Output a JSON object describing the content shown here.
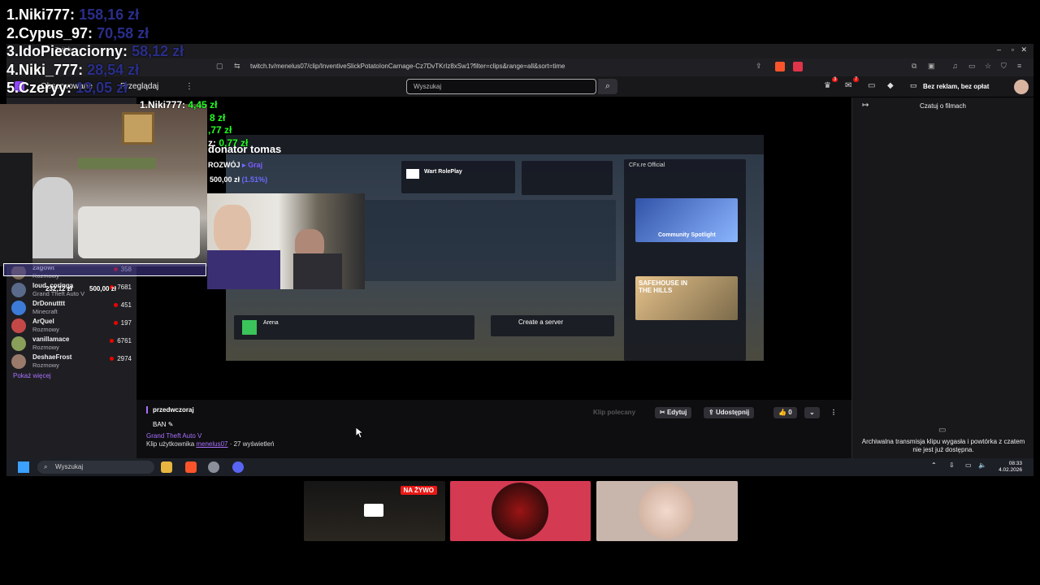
{
  "leaderboard": [
    {
      "rank_name": "1.Niki777:",
      "amount": "158,16 zł"
    },
    {
      "rank_name": "2.Cypus_97:",
      "amount": "70,58 zł"
    },
    {
      "rank_name": "3.IdoPiecaciorny:",
      "amount": "58,12 zł"
    },
    {
      "rank_name": "4.Niki_777:",
      "amount": "28,54 zł"
    },
    {
      "rank_name": "5.Czeryy:",
      "amount": "13,05 zł"
    }
  ],
  "browser": {
    "tab_title": "Twitch",
    "url": "twitch.tv/menelus07/clip/InventiveSlickPotatoIonCarnage-Cz7DvTKrIz8xSw1?filter=clips&range=all&sort=time"
  },
  "twitch_nav": {
    "followed": "Obserwowane",
    "browse": "Przeglądaj",
    "search_placeholder": "Wyszukaj",
    "ad_free": "Bez reklam, bez opłat",
    "notif1": "3",
    "notif2": "7"
  },
  "sidebar": {
    "items": [
      {
        "name": "zagowt",
        "game": "Rozmowy",
        "viewers": "358"
      },
      {
        "name": "loud_coringa",
        "game": "Grand Theft Auto V",
        "viewers": "7681"
      },
      {
        "name": "DrDonutttt",
        "game": "Minecraft",
        "viewers": "451"
      },
      {
        "name": "ArQuel",
        "game": "Rozmowy",
        "viewers": "197"
      },
      {
        "name": "vanillamace",
        "game": "Rozmowy",
        "viewers": "6761"
      },
      {
        "name": "DeshaeFrost",
        "game": "Rozmowy",
        "viewers": "2974"
      }
    ],
    "show_more": "Pokaż więcej"
  },
  "clip_screen": {
    "server_name": "Wart RolePlay",
    "play_label": "Graj",
    "arena": "Arena",
    "create_server": "Create a server",
    "official": "CFx.re Official",
    "community_spotlight": "Community Spotlight",
    "safehouse": "SAFEHOUSE IN THE HILLS"
  },
  "overlay": {
    "donors": [
      {
        "name": "1.Niki777: ",
        "amount": "4,45 zł"
      },
      {
        "name": "",
        "amount": "8 zł"
      },
      {
        "name": "",
        "amount": ",77 zł"
      },
      {
        "name": "z: ",
        "amount": "0,77 zł"
      }
    ],
    "donator": "donator tomas",
    "development": "ROZWÓJ",
    "goal_current": "500,00 zł",
    "goal_pct": "(1.51%)",
    "bar_left": "232,12 zł",
    "bar_right": "500,00 zł"
  },
  "clip_info": {
    "category": "przedwczoraj",
    "title": "BAN",
    "game": "Grand Theft Auto V",
    "by_prefix": "Klip użytkownika ",
    "by_user": "menelus07",
    "by_suffix": " · 27 wyświetleń",
    "recommended": "Klip polecany",
    "edit": "Edytuj",
    "share": "Udostępnij",
    "likes": "0"
  },
  "chat": {
    "title": "Czatuj o filmach",
    "unavailable": "Archiwalna transmisja klipu wygasła i powtórka z czatem nie jest już dostępna."
  },
  "taskbar": {
    "search": "Wyszukaj",
    "time": "08:33",
    "date": "4.02.2026"
  },
  "tiles": {
    "live_badge": "NA ŻYWO"
  }
}
